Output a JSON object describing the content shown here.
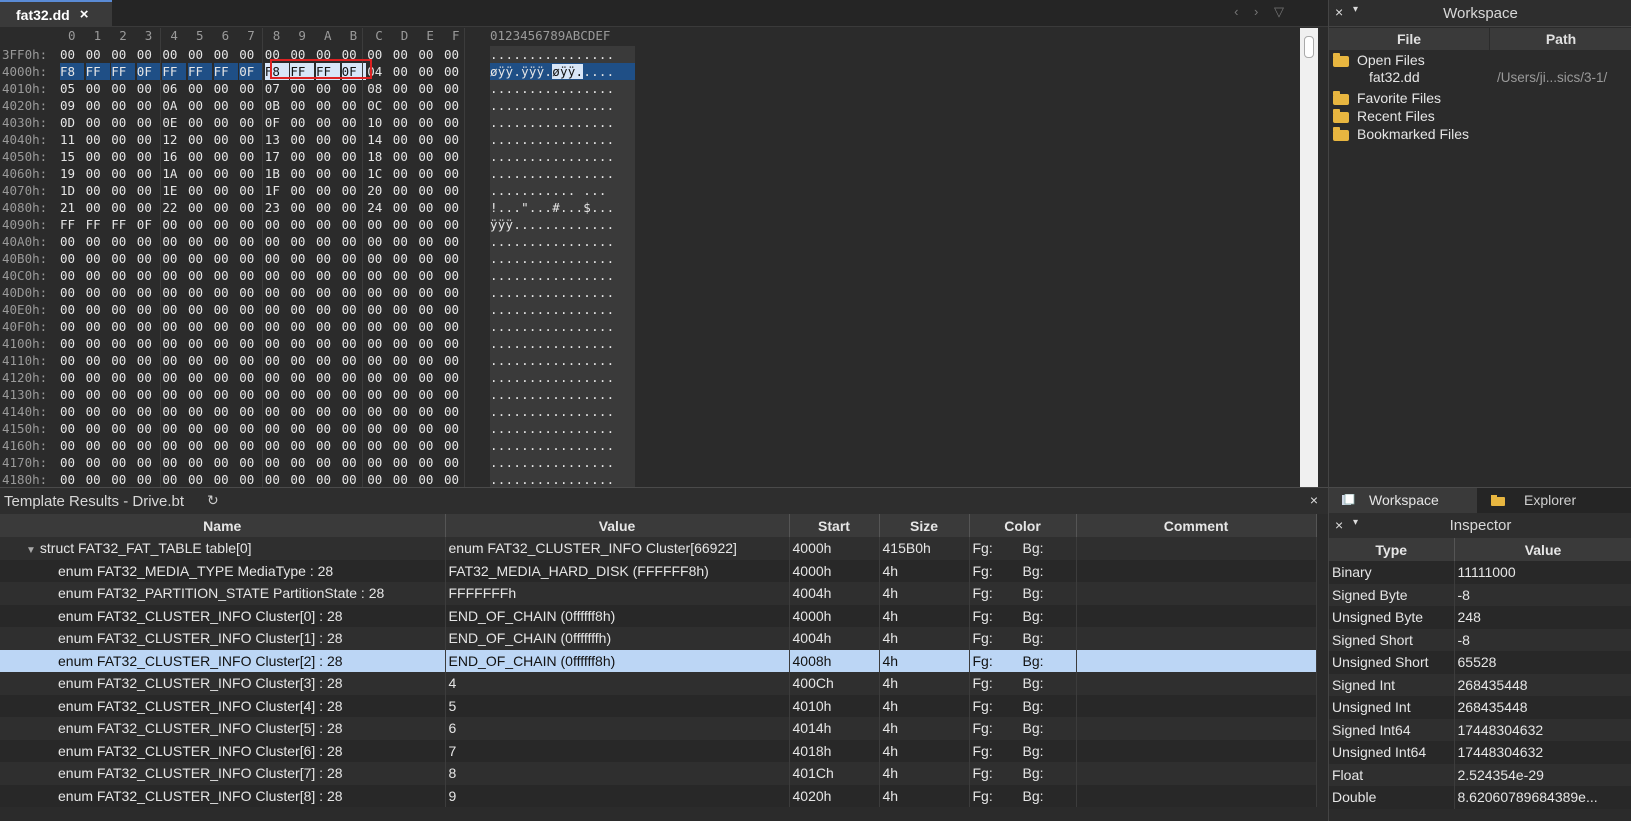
{
  "editor": {
    "tab_label": "fat32.dd",
    "tab_close": "×",
    "nav": "‹ › ▽",
    "header_cols": [
      "0",
      "1",
      "2",
      "3",
      "4",
      "5",
      "6",
      "7",
      "8",
      "9",
      "A",
      "B",
      "C",
      "D",
      "E",
      "F"
    ],
    "ascii_header": "0123456789ABCDEF",
    "rows": [
      {
        "addr": "3FF0h:",
        "bytes": [
          "00",
          "00",
          "00",
          "00",
          "00",
          "00",
          "00",
          "00",
          "00",
          "00",
          "00",
          "00",
          "00",
          "00",
          "00",
          "00"
        ],
        "ascii": "................"
      },
      {
        "addr": "4000h:",
        "bytes": [
          "F8",
          "FF",
          "FF",
          "0F",
          "FF",
          "FF",
          "FF",
          "0F",
          "F8",
          "FF",
          "FF",
          "0F",
          "04",
          "00",
          "00",
          "00"
        ],
        "ascii": "øÿÿ.ÿÿÿ.øÿÿ.....",
        "selected": true
      },
      {
        "addr": "4010h:",
        "bytes": [
          "05",
          "00",
          "00",
          "00",
          "06",
          "00",
          "00",
          "00",
          "07",
          "00",
          "00",
          "00",
          "08",
          "00",
          "00",
          "00"
        ],
        "ascii": "................"
      },
      {
        "addr": "4020h:",
        "bytes": [
          "09",
          "00",
          "00",
          "00",
          "0A",
          "00",
          "00",
          "00",
          "0B",
          "00",
          "00",
          "00",
          "0C",
          "00",
          "00",
          "00"
        ],
        "ascii": "................"
      },
      {
        "addr": "4030h:",
        "bytes": [
          "0D",
          "00",
          "00",
          "00",
          "0E",
          "00",
          "00",
          "00",
          "0F",
          "00",
          "00",
          "00",
          "10",
          "00",
          "00",
          "00"
        ],
        "ascii": "................"
      },
      {
        "addr": "4040h:",
        "bytes": [
          "11",
          "00",
          "00",
          "00",
          "12",
          "00",
          "00",
          "00",
          "13",
          "00",
          "00",
          "00",
          "14",
          "00",
          "00",
          "00"
        ],
        "ascii": "................"
      },
      {
        "addr": "4050h:",
        "bytes": [
          "15",
          "00",
          "00",
          "00",
          "16",
          "00",
          "00",
          "00",
          "17",
          "00",
          "00",
          "00",
          "18",
          "00",
          "00",
          "00"
        ],
        "ascii": "................"
      },
      {
        "addr": "4060h:",
        "bytes": [
          "19",
          "00",
          "00",
          "00",
          "1A",
          "00",
          "00",
          "00",
          "1B",
          "00",
          "00",
          "00",
          "1C",
          "00",
          "00",
          "00"
        ],
        "ascii": "................"
      },
      {
        "addr": "4070h:",
        "bytes": [
          "1D",
          "00",
          "00",
          "00",
          "1E",
          "00",
          "00",
          "00",
          "1F",
          "00",
          "00",
          "00",
          "20",
          "00",
          "00",
          "00"
        ],
        "ascii": "........... ..."
      },
      {
        "addr": "4080h:",
        "bytes": [
          "21",
          "00",
          "00",
          "00",
          "22",
          "00",
          "00",
          "00",
          "23",
          "00",
          "00",
          "00",
          "24",
          "00",
          "00",
          "00"
        ],
        "ascii": "!...\"...#...$..."
      },
      {
        "addr": "4090h:",
        "bytes": [
          "FF",
          "FF",
          "FF",
          "0F",
          "00",
          "00",
          "00",
          "00",
          "00",
          "00",
          "00",
          "00",
          "00",
          "00",
          "00",
          "00"
        ],
        "ascii": "ÿÿÿ............."
      },
      {
        "addr": "40A0h:",
        "bytes": [
          "00",
          "00",
          "00",
          "00",
          "00",
          "00",
          "00",
          "00",
          "00",
          "00",
          "00",
          "00",
          "00",
          "00",
          "00",
          "00"
        ],
        "ascii": "................"
      },
      {
        "addr": "40B0h:",
        "bytes": [
          "00",
          "00",
          "00",
          "00",
          "00",
          "00",
          "00",
          "00",
          "00",
          "00",
          "00",
          "00",
          "00",
          "00",
          "00",
          "00"
        ],
        "ascii": "................"
      },
      {
        "addr": "40C0h:",
        "bytes": [
          "00",
          "00",
          "00",
          "00",
          "00",
          "00",
          "00",
          "00",
          "00",
          "00",
          "00",
          "00",
          "00",
          "00",
          "00",
          "00"
        ],
        "ascii": "................"
      },
      {
        "addr": "40D0h:",
        "bytes": [
          "00",
          "00",
          "00",
          "00",
          "00",
          "00",
          "00",
          "00",
          "00",
          "00",
          "00",
          "00",
          "00",
          "00",
          "00",
          "00"
        ],
        "ascii": "................"
      },
      {
        "addr": "40E0h:",
        "bytes": [
          "00",
          "00",
          "00",
          "00",
          "00",
          "00",
          "00",
          "00",
          "00",
          "00",
          "00",
          "00",
          "00",
          "00",
          "00",
          "00"
        ],
        "ascii": "................"
      },
      {
        "addr": "40F0h:",
        "bytes": [
          "00",
          "00",
          "00",
          "00",
          "00",
          "00",
          "00",
          "00",
          "00",
          "00",
          "00",
          "00",
          "00",
          "00",
          "00",
          "00"
        ],
        "ascii": "................"
      },
      {
        "addr": "4100h:",
        "bytes": [
          "00",
          "00",
          "00",
          "00",
          "00",
          "00",
          "00",
          "00",
          "00",
          "00",
          "00",
          "00",
          "00",
          "00",
          "00",
          "00"
        ],
        "ascii": "................"
      },
      {
        "addr": "4110h:",
        "bytes": [
          "00",
          "00",
          "00",
          "00",
          "00",
          "00",
          "00",
          "00",
          "00",
          "00",
          "00",
          "00",
          "00",
          "00",
          "00",
          "00"
        ],
        "ascii": "................"
      },
      {
        "addr": "4120h:",
        "bytes": [
          "00",
          "00",
          "00",
          "00",
          "00",
          "00",
          "00",
          "00",
          "00",
          "00",
          "00",
          "00",
          "00",
          "00",
          "00",
          "00"
        ],
        "ascii": "................"
      },
      {
        "addr": "4130h:",
        "bytes": [
          "00",
          "00",
          "00",
          "00",
          "00",
          "00",
          "00",
          "00",
          "00",
          "00",
          "00",
          "00",
          "00",
          "00",
          "00",
          "00"
        ],
        "ascii": "................"
      },
      {
        "addr": "4140h:",
        "bytes": [
          "00",
          "00",
          "00",
          "00",
          "00",
          "00",
          "00",
          "00",
          "00",
          "00",
          "00",
          "00",
          "00",
          "00",
          "00",
          "00"
        ],
        "ascii": "................"
      },
      {
        "addr": "4150h:",
        "bytes": [
          "00",
          "00",
          "00",
          "00",
          "00",
          "00",
          "00",
          "00",
          "00",
          "00",
          "00",
          "00",
          "00",
          "00",
          "00",
          "00"
        ],
        "ascii": "................"
      },
      {
        "addr": "4160h:",
        "bytes": [
          "00",
          "00",
          "00",
          "00",
          "00",
          "00",
          "00",
          "00",
          "00",
          "00",
          "00",
          "00",
          "00",
          "00",
          "00",
          "00"
        ],
        "ascii": "................"
      },
      {
        "addr": "4170h:",
        "bytes": [
          "00",
          "00",
          "00",
          "00",
          "00",
          "00",
          "00",
          "00",
          "00",
          "00",
          "00",
          "00",
          "00",
          "00",
          "00",
          "00"
        ],
        "ascii": "................"
      },
      {
        "addr": "4180h:",
        "bytes": [
          "00",
          "00",
          "00",
          "00",
          "00",
          "00",
          "00",
          "00",
          "00",
          "00",
          "00",
          "00",
          "00",
          "00",
          "00",
          "00"
        ],
        "ascii": "................"
      }
    ]
  },
  "workspace": {
    "title": "Workspace",
    "close": "×",
    "dropdown": "▾",
    "col_file": "File",
    "col_path": "Path",
    "open_files": "Open Files",
    "open_file_name": "fat32.dd",
    "open_file_path": "/Users/ji...sics/3-1/",
    "favorite_files": "Favorite Files",
    "recent_files": "Recent Files",
    "bookmarked_files": "Bookmarked Files"
  },
  "results": {
    "title": "Template Results - Drive.bt",
    "refresh": "↻",
    "close": "×",
    "columns": [
      "Name",
      "Value",
      "Start",
      "Size",
      "Color",
      "Comment"
    ],
    "rows": [
      {
        "name": "struct FAT32_FAT_TABLE table[0]",
        "value": "enum FAT32_CLUSTER_INFO Cluster[66922]",
        "start": "4000h",
        "size": "415B0h",
        "fg": "Fg:",
        "bg": "Bg:",
        "root": true
      },
      {
        "name": "enum FAT32_MEDIA_TYPE MediaType : 28",
        "value": "FAT32_MEDIA_HARD_DISK (FFFFFF8h)",
        "start": "4000h",
        "size": "4h",
        "fg": "Fg:",
        "bg": "Bg:"
      },
      {
        "name": "enum FAT32_PARTITION_STATE PartitionState : 28",
        "value": "FFFFFFFh",
        "start": "4004h",
        "size": "4h",
        "fg": "Fg:",
        "bg": "Bg:"
      },
      {
        "name": "enum FAT32_CLUSTER_INFO Cluster[0] : 28",
        "value": "END_OF_CHAIN (0ffffff8h)",
        "start": "4000h",
        "size": "4h",
        "fg": "Fg:",
        "bg": "Bg:"
      },
      {
        "name": "enum FAT32_CLUSTER_INFO Cluster[1] : 28",
        "value": "END_OF_CHAIN (0fffffffh)",
        "start": "4004h",
        "size": "4h",
        "fg": "Fg:",
        "bg": "Bg:"
      },
      {
        "name": "enum FAT32_CLUSTER_INFO Cluster[2] : 28",
        "value": "END_OF_CHAIN (0ffffff8h)",
        "start": "4008h",
        "size": "4h",
        "fg": "Fg:",
        "bg": "Bg:",
        "selected": true
      },
      {
        "name": "enum FAT32_CLUSTER_INFO Cluster[3] : 28",
        "value": "4",
        "start": "400Ch",
        "size": "4h",
        "fg": "Fg:",
        "bg": "Bg:"
      },
      {
        "name": "enum FAT32_CLUSTER_INFO Cluster[4] : 28",
        "value": "5",
        "start": "4010h",
        "size": "4h",
        "fg": "Fg:",
        "bg": "Bg:"
      },
      {
        "name": "enum FAT32_CLUSTER_INFO Cluster[5] : 28",
        "value": "6",
        "start": "4014h",
        "size": "4h",
        "fg": "Fg:",
        "bg": "Bg:"
      },
      {
        "name": "enum FAT32_CLUSTER_INFO Cluster[6] : 28",
        "value": "7",
        "start": "4018h",
        "size": "4h",
        "fg": "Fg:",
        "bg": "Bg:"
      },
      {
        "name": "enum FAT32_CLUSTER_INFO Cluster[7] : 28",
        "value": "8",
        "start": "401Ch",
        "size": "4h",
        "fg": "Fg:",
        "bg": "Bg:"
      },
      {
        "name": "enum FAT32_CLUSTER_INFO Cluster[8] : 28",
        "value": "9",
        "start": "4020h",
        "size": "4h",
        "fg": "Fg:",
        "bg": "Bg:"
      }
    ]
  },
  "inspector": {
    "tab_workspace": "Workspace",
    "tab_explorer": "Explorer",
    "title": "Inspector",
    "close": "×",
    "dropdown": "▾",
    "col_type": "Type",
    "col_value": "Value",
    "rows": [
      {
        "type": "Binary",
        "value": "11111000"
      },
      {
        "type": "Signed Byte",
        "value": "-8"
      },
      {
        "type": "Unsigned Byte",
        "value": "248"
      },
      {
        "type": "Signed Short",
        "value": "-8"
      },
      {
        "type": "Unsigned Short",
        "value": "65528"
      },
      {
        "type": "Signed Int",
        "value": "268435448"
      },
      {
        "type": "Unsigned Int",
        "value": "268435448"
      },
      {
        "type": "Signed Int64",
        "value": "17448304632"
      },
      {
        "type": "Unsigned Int64",
        "value": "17448304632"
      },
      {
        "type": "Float",
        "value": "2.524354e-29"
      },
      {
        "type": "Double",
        "value": "8.62060789684389e..."
      }
    ]
  },
  "colors": {
    "selection_blue": "#1f4f86",
    "selected_row": "#bcd6f5",
    "highlight_box": "#dd2222",
    "folder": "#e8b640"
  }
}
